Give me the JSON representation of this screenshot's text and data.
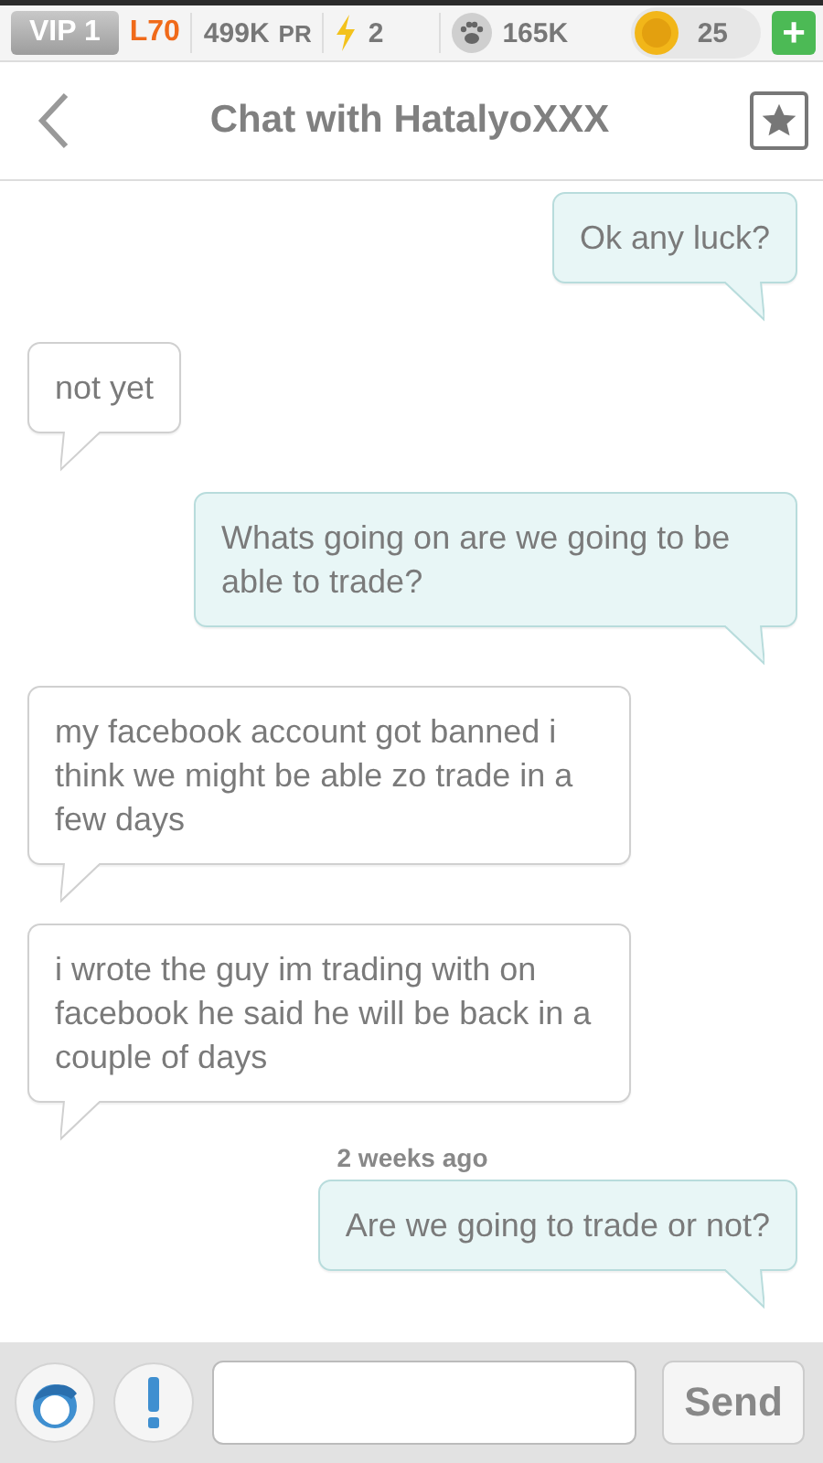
{
  "status_bar": {
    "vip": "VIP 1",
    "level": "L70",
    "power": "499K",
    "power_unit": "PR",
    "energy": "2",
    "paws": "165K",
    "coins": "25",
    "add": "+"
  },
  "header": {
    "title": "Chat with HatalyoXXX",
    "starred": false
  },
  "messages": [
    {
      "kind": "bubble",
      "mine": true,
      "text": "Ok any luck?"
    },
    {
      "kind": "bubble",
      "mine": false,
      "text": "not yet"
    },
    {
      "kind": "bubble",
      "mine": true,
      "text": "Whats going on are we going to be able to trade?"
    },
    {
      "kind": "bubble",
      "mine": false,
      "text": "my facebook account got banned i think we might be able zo trade in a few days"
    },
    {
      "kind": "bubble",
      "mine": false,
      "text": "i wrote the guy im trading with on facebook he said he will be back in a couple of days"
    },
    {
      "kind": "time",
      "text": "2 weeks ago"
    },
    {
      "kind": "bubble",
      "mine": true,
      "text": "Are we going to trade or not?"
    }
  ],
  "composer": {
    "send": "Send"
  }
}
